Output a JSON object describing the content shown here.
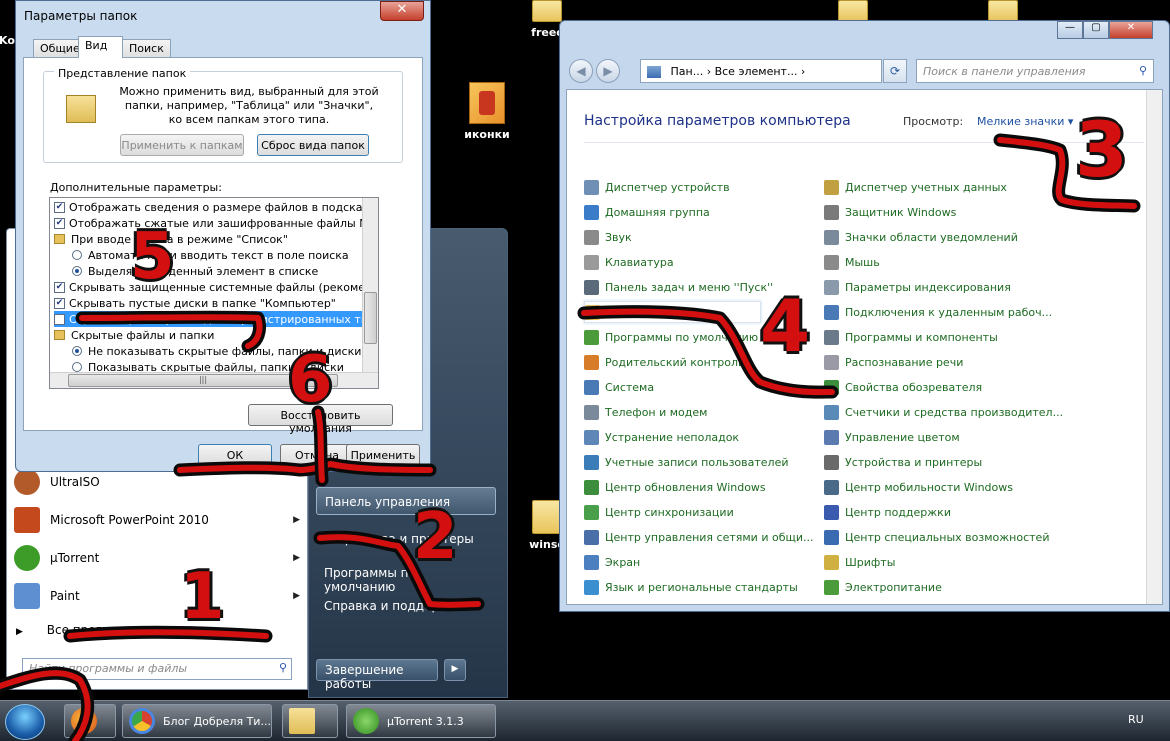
{
  "desktop": {
    "icons": [
      {
        "label": "иконки"
      },
      {
        "label": "freec"
      },
      {
        "label": "winse"
      },
      {
        "label": "Ko"
      }
    ]
  },
  "start_menu": {
    "programs": [
      {
        "label": "UltraISO",
        "color": "#b35a2b"
      },
      {
        "label": "Microsoft PowerPoint 2010",
        "color": "#c44a1e"
      },
      {
        "label": "µTorrent",
        "color": "#3d9b28"
      },
      {
        "label": "Paint",
        "color": "#5d8fd1"
      }
    ],
    "all_programs": "Все программы",
    "search_placeholder": "Найти программы и файлы",
    "right_items": [
      "Панель управления",
      "Устройства и принтеры",
      "Программы по умолчанию",
      "Справка и поддержка"
    ],
    "shutdown": "Завершение работы"
  },
  "folder_options": {
    "title": "Параметры папок",
    "tabs": [
      "Общие",
      "Вид",
      "Поиск"
    ],
    "group_title": "Представление папок",
    "group_desc": "Можно применить вид, выбранный для этой папки, например, \"Таблица\" или \"Значки\", ко всем папкам этого типа.",
    "apply_to_folders": "Применить к папкам",
    "reset_view": "Сброс вида папок",
    "advanced_label": "Дополнительные параметры:",
    "tree": [
      {
        "kind": "check",
        "checked": true,
        "label": "Отображать сведения о размере файлов в подсказках"
      },
      {
        "kind": "check",
        "checked": true,
        "label": "Отображать сжатые или зашифрованные файлы NTFS"
      },
      {
        "kind": "folder",
        "label": "При вводе текста в режиме \"Список\""
      },
      {
        "kind": "radio",
        "on": false,
        "label": "Автоматически вводить текст в поле поиска"
      },
      {
        "kind": "radio",
        "on": true,
        "label": "Выделять введенный элемент в списке"
      },
      {
        "kind": "check",
        "checked": true,
        "label": "Скрывать защищенные системные файлы (рекомендуется)"
      },
      {
        "kind": "check",
        "checked": true,
        "label": "Скрывать пустые диски в папке \"Компьютер\""
      },
      {
        "kind": "check",
        "checked": false,
        "selected": true,
        "label": "Скрывать расширения для зарегистрированных типов файлов"
      },
      {
        "kind": "folder",
        "label": "Скрытые файлы и папки"
      },
      {
        "kind": "radio",
        "on": true,
        "label": "Не показывать скрытые файлы, папки и диски"
      },
      {
        "kind": "radio",
        "on": false,
        "label": "Показывать скрытые файлы, папки и диски"
      }
    ],
    "restore_defaults": "Восстановить умолчания",
    "ok": "ОК",
    "cancel": "Отмена",
    "apply": "Применить"
  },
  "control_panel": {
    "address": "Пан... › Все элемент... ›",
    "search_placeholder": "Поиск в панели управления",
    "heading": "Настройка параметров компьютера",
    "view_label": "Просмотр:",
    "view_value": "Мелкие значки ▾",
    "col1": [
      {
        "label": "Диспетчер устройств",
        "color": "#6f8fb5"
      },
      {
        "label": "Домашняя группа",
        "color": "#3b7cc8"
      },
      {
        "label": "Звук",
        "color": "#8a8a8a"
      },
      {
        "label": "Клавиатура",
        "color": "#9a9a9a"
      },
      {
        "label": "Панель задач и меню ''Пуск''",
        "color": "#5a6a7a"
      },
      {
        "label": "Параметры папок",
        "color": "#e2c05a"
      },
      {
        "label": "Программы по умолчанию",
        "color": "#4c9b3a"
      },
      {
        "label": "Родительский контроль",
        "color": "#d77d2a"
      },
      {
        "label": "Система",
        "color": "#4a7ab5"
      },
      {
        "label": "Телефон и модем",
        "color": "#7a8a9a"
      },
      {
        "label": "Устранение неполадок",
        "color": "#5e87b8"
      },
      {
        "label": "Учетные записи пользователей",
        "color": "#3a7db8"
      },
      {
        "label": "Центр обновления Windows",
        "color": "#3c8e3c"
      },
      {
        "label": "Центр синхронизации",
        "color": "#4aa04a"
      },
      {
        "label": "Центр управления сетями и общи...",
        "color": "#4a6fa8"
      },
      {
        "label": "Экран",
        "color": "#4c7fc0"
      },
      {
        "label": "Язык и региональные стандарты",
        "color": "#3a8fd0"
      }
    ],
    "col2": [
      {
        "label": "Диспетчер учетных данных",
        "color": "#c0a040"
      },
      {
        "label": "Защитник Windows",
        "color": "#7a7a7a"
      },
      {
        "label": "Значки области уведомлений",
        "color": "#7a8a9a"
      },
      {
        "label": "Мышь",
        "color": "#8a8a8a"
      },
      {
        "label": "Параметры индексирования",
        "color": "#8a9aaa"
      },
      {
        "label": "Подключения к удаленным рабоч...",
        "color": "#4a7ab5"
      },
      {
        "label": "Программы и компоненты",
        "color": "#6a7a8a"
      },
      {
        "label": "Распознавание речи",
        "color": "#9a9aa6"
      },
      {
        "label": "Свойства обозревателя",
        "color": "#3c8e3c"
      },
      {
        "label": "Счетчики и средства производител...",
        "color": "#5a8ab8"
      },
      {
        "label": "Управление цветом",
        "color": "#5a7ab0"
      },
      {
        "label": "Устройства и принтеры",
        "color": "#6a6a6a"
      },
      {
        "label": "Центр мобильности Windows",
        "color": "#4a6a8a"
      },
      {
        "label": "Центр поддержки",
        "color": "#3a5ab0"
      },
      {
        "label": "Центр специальных возможностей",
        "color": "#3a6ab0"
      },
      {
        "label": "Шрифты",
        "color": "#d0b040"
      },
      {
        "label": "Электропитание",
        "color": "#4c9b3a"
      }
    ]
  },
  "taskbar": {
    "items": [
      {
        "label": "",
        "color": "#e66a1a"
      },
      {
        "label": "Блог Добреля Ти...",
        "color": "#d8412f"
      },
      {
        "label": "",
        "color": "#e6c15c"
      },
      {
        "label": "µTorrent 3.1.3",
        "color": "#3d9b28"
      }
    ],
    "lang": "RU"
  },
  "annotations": [
    "1",
    "2",
    "3",
    "4",
    "5",
    "6"
  ]
}
